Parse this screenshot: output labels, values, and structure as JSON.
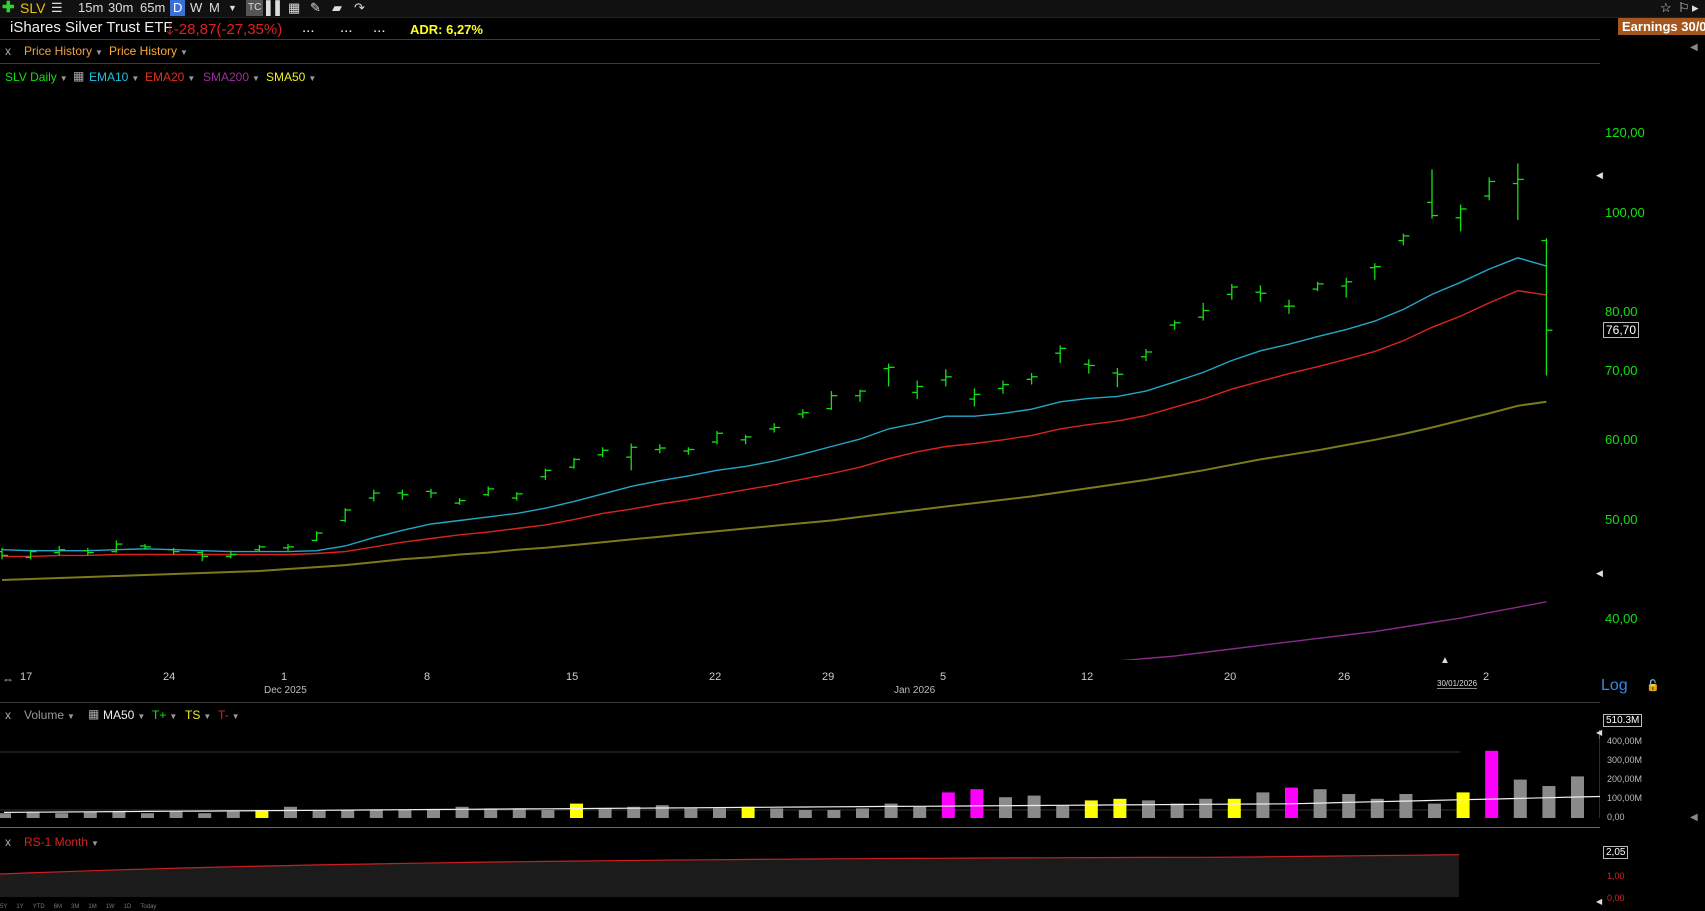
{
  "toolbar": {
    "symbol": "SLV",
    "intervals": [
      "15m",
      "30m",
      "65m",
      "D",
      "W",
      "M"
    ],
    "active_interval": "D"
  },
  "header": {
    "name": "iShares Silver Trust ETF",
    "change": "-28,87",
    "change_pct": "(-27,35%)",
    "dots": [
      "...",
      "...",
      "..."
    ],
    "adr": "ADR: 6,27%",
    "earnings": "Earnings 30/0",
    "tab1": "Price History",
    "tab2": "Price History"
  },
  "legend": {
    "series": "SLV Daily",
    "ema10": "EMA10",
    "ema20": "EMA20",
    "sma200": "SMA200",
    "sma50": "SMA50",
    "close": "x"
  },
  "colors": {
    "bar": "#13e013",
    "ema10": "#22a7c8",
    "ema20": "#d9241e",
    "sma50": "#7a7a1e",
    "sma200": "#8a2a8a",
    "vol_gray": "#8a8a8a",
    "vol_yellow": "#ffff00",
    "vol_magenta": "#ff00ff"
  },
  "price_axis": {
    "ticks": [
      "120,00",
      "100,00",
      "80,00",
      "70,00",
      "60,00",
      "50,00",
      "40,00"
    ],
    "last": "76,70",
    "scale": "Log"
  },
  "date_axis": {
    "ticks": [
      "17",
      "24",
      "1",
      "8",
      "15",
      "22",
      "29",
      "5",
      "12",
      "20",
      "26",
      "2"
    ],
    "months": [
      "Dec 2025",
      "Jan 2026"
    ],
    "selected": "30/01/2026"
  },
  "chart_data": {
    "type": "bar",
    "ylim": [
      36,
      130
    ],
    "log": true,
    "series": [
      {
        "name": "SLV Daily",
        "type": "ohlc",
        "values": [
          [
            46.4,
            46.8,
            45.6,
            46.0
          ],
          [
            45.8,
            46.6,
            45.6,
            46.4
          ],
          [
            46.3,
            47.0,
            46.0,
            46.6
          ],
          [
            46.5,
            46.8,
            46.0,
            46.3
          ],
          [
            46.4,
            47.6,
            46.3,
            47.2
          ],
          [
            47.0,
            47.2,
            46.6,
            46.9
          ],
          [
            46.6,
            46.8,
            46.1,
            46.4
          ],
          [
            46.3,
            46.5,
            45.4,
            45.9
          ],
          [
            45.9,
            46.5,
            45.7,
            46.1
          ],
          [
            46.6,
            47.1,
            46.4,
            46.9
          ],
          [
            46.8,
            47.2,
            46.5,
            46.9
          ],
          [
            47.6,
            48.6,
            47.5,
            48.4
          ],
          [
            49.8,
            51.2,
            49.6,
            51.0
          ],
          [
            52.4,
            53.4,
            52.0,
            53.0
          ],
          [
            53.0,
            53.4,
            52.2,
            52.8
          ],
          [
            53.2,
            53.5,
            52.4,
            53.0
          ],
          [
            51.8,
            52.4,
            51.6,
            52.1
          ],
          [
            52.8,
            53.8,
            52.6,
            53.5
          ],
          [
            52.4,
            53.1,
            52.1,
            52.9
          ],
          [
            55.0,
            56.0,
            54.6,
            55.8
          ],
          [
            56.2,
            57.4,
            56.0,
            57.2
          ],
          [
            57.8,
            58.8,
            57.5,
            58.4
          ],
          [
            57.5,
            59.3,
            55.8,
            58.8
          ],
          [
            58.5,
            59.2,
            58.0,
            58.7
          ],
          [
            58.3,
            58.8,
            57.8,
            58.5
          ],
          [
            59.5,
            61.0,
            59.2,
            60.7
          ],
          [
            59.8,
            60.5,
            59.2,
            60.2
          ],
          [
            61.3,
            62.1,
            60.8,
            61.5
          ],
          [
            63.4,
            64.1,
            62.8,
            63.6
          ],
          [
            64.2,
            66.8,
            64.0,
            66.1
          ],
          [
            66.1,
            67.0,
            65.2,
            66.8
          ],
          [
            70.3,
            71.1,
            67.5,
            70.5
          ],
          [
            66.6,
            68.4,
            65.6,
            67.5
          ],
          [
            68.5,
            70.2,
            67.5,
            69.0
          ],
          [
            65.6,
            67.2,
            64.5,
            66.3
          ],
          [
            67.2,
            68.4,
            66.4,
            67.8
          ],
          [
            68.6,
            69.6,
            67.8,
            69.0
          ],
          [
            72.8,
            74.1,
            71.2,
            73.6
          ],
          [
            71.0,
            71.8,
            69.5,
            70.8
          ],
          [
            69.6,
            70.4,
            67.4,
            69.4
          ],
          [
            72.2,
            73.5,
            71.5,
            73.0
          ],
          [
            77.6,
            78.4,
            76.8,
            78.0
          ],
          [
            79.0,
            81.6,
            78.4,
            80.2
          ],
          [
            83.2,
            85.2,
            82.2,
            84.6
          ],
          [
            83.6,
            84.9,
            81.8,
            83.4
          ],
          [
            81.0,
            82.2,
            79.6,
            81.0
          ],
          [
            84.2,
            85.6,
            83.8,
            85.2
          ],
          [
            84.8,
            86.4,
            82.6,
            85.6
          ],
          [
            88.4,
            89.3,
            86.0,
            88.6
          ],
          [
            94.0,
            95.5,
            93.0,
            95.0
          ],
          [
            102.5,
            110.5,
            98.8,
            99.5
          ],
          [
            99.0,
            102.0,
            96.0,
            101.0
          ],
          [
            104.0,
            108.5,
            103.0,
            107.5
          ],
          [
            107.0,
            112.0,
            98.5,
            108.0
          ],
          [
            94.0,
            94.5,
            69.2,
            76.7
          ]
        ]
      },
      {
        "name": "EMA10",
        "values": [
          46.6,
          46.5,
          46.5,
          46.5,
          46.6,
          46.7,
          46.6,
          46.5,
          46.4,
          46.4,
          46.4,
          46.5,
          47.0,
          47.9,
          48.7,
          49.4,
          49.8,
          50.2,
          50.6,
          51.2,
          52.0,
          52.9,
          53.8,
          54.5,
          55.1,
          55.8,
          56.3,
          57.0,
          57.9,
          58.9,
          59.9,
          61.3,
          62.1,
          63.1,
          63.1,
          63.5,
          64.1,
          65.2,
          65.7,
          66.0,
          66.8,
          68.2,
          69.7,
          71.6,
          73.2,
          74.3,
          75.6,
          76.8,
          78.3,
          80.4,
          83.2,
          85.5,
          88.1,
          90.4,
          88.7
        ]
      },
      {
        "name": "EMA20",
        "values": [
          45.9,
          45.9,
          46.0,
          46.0,
          46.1,
          46.1,
          46.1,
          46.1,
          46.1,
          46.1,
          46.1,
          46.2,
          46.4,
          46.9,
          47.4,
          47.8,
          48.2,
          48.5,
          48.9,
          49.3,
          49.9,
          50.6,
          51.1,
          51.7,
          52.2,
          52.8,
          53.4,
          54.0,
          54.7,
          55.4,
          56.2,
          57.3,
          58.2,
          58.9,
          59.3,
          59.8,
          60.4,
          61.3,
          61.9,
          62.4,
          63.2,
          64.4,
          65.6,
          67.1,
          68.3,
          69.5,
          70.6,
          71.8,
          73.1,
          74.9,
          77.2,
          79.2,
          81.6,
          83.9,
          83.1
        ]
      },
      {
        "name": "SMA50",
        "values": [
          43.5,
          43.6,
          43.7,
          43.8,
          43.9,
          44.0,
          44.1,
          44.2,
          44.3,
          44.4,
          44.6,
          44.8,
          45.0,
          45.3,
          45.6,
          45.8,
          46.1,
          46.3,
          46.6,
          46.8,
          47.1,
          47.4,
          47.7,
          48.0,
          48.3,
          48.6,
          48.9,
          49.2,
          49.5,
          49.8,
          50.2,
          50.6,
          51.0,
          51.4,
          51.8,
          52.2,
          52.6,
          53.1,
          53.6,
          54.1,
          54.6,
          55.2,
          55.8,
          56.5,
          57.2,
          57.8,
          58.4,
          59.1,
          59.8,
          60.6,
          61.5,
          62.5,
          63.5,
          64.6,
          65.2
        ]
      },
      {
        "name": "SMA200",
        "values": [
          31.0,
          31.1,
          31.2,
          31.3,
          31.4,
          31.5,
          31.6,
          31.7,
          31.8,
          31.9,
          32.0,
          32.1,
          32.2,
          32.3,
          32.4,
          32.5,
          32.6,
          32.7,
          32.8,
          32.9,
          33.0,
          33.1,
          33.2,
          33.4,
          33.5,
          33.7,
          33.8,
          33.9,
          34.1,
          34.3,
          34.4,
          34.6,
          34.8,
          35.0,
          35.2,
          35.4,
          35.6,
          35.8,
          36.0,
          36.2,
          36.4,
          36.6,
          36.9,
          37.2,
          37.5,
          37.8,
          38.1,
          38.4,
          38.7,
          39.1,
          39.5,
          39.9,
          40.4,
          40.9,
          41.4
        ]
      }
    ]
  },
  "volume": {
    "title": "Volume",
    "ma": "MA50",
    "t_plus": "T+",
    "ts": "TS",
    "t_minus": "T-",
    "last": "510.3M",
    "ticks": [
      "400,00M",
      "300,00M",
      "200,00M",
      "100,00M",
      "0,00"
    ],
    "values": [
      30,
      35,
      30,
      35,
      40,
      30,
      45,
      40,
      30,
      40,
      45,
      45,
      40,
      50,
      70,
      75,
      50,
      60,
      55,
      50,
      75,
      50,
      60,
      70,
      80,
      60,
      50,
      55,
      75,
      80,
      65,
      45,
      80,
      50,
      45,
      50,
      55,
      80,
      75,
      85,
      60,
      50,
      60,
      50,
      40,
      70,
      60,
      50,
      80,
      150,
      155,
      125,
      130,
      130,
      95,
      110,
      145,
      145,
      75,
      115,
      120,
      120,
      95,
      90,
      120,
      120,
      135,
      180,
      165,
      110,
      95,
      170,
      170,
      130,
      110,
      150,
      150,
      180,
      210,
      200,
      395,
      215,
      185,
      245,
      485,
      510.3
    ],
    "vol_bars": [
      [
        0.03,
        "g"
      ],
      [
        0.04,
        "g"
      ],
      [
        0.03,
        "g"
      ],
      [
        0.04,
        "g"
      ],
      [
        0.04,
        "g"
      ],
      [
        0.03,
        "g"
      ],
      [
        0.04,
        "g"
      ],
      [
        0.03,
        "g"
      ],
      [
        0.04,
        "g"
      ],
      [
        0.05,
        "y"
      ],
      [
        0.07,
        "g"
      ],
      [
        0.05,
        "g"
      ],
      [
        0.05,
        "g"
      ],
      [
        0.05,
        "g"
      ],
      [
        0.05,
        "g"
      ],
      [
        0.05,
        "g"
      ],
      [
        0.07,
        "g"
      ],
      [
        0.06,
        "g"
      ],
      [
        0.06,
        "g"
      ],
      [
        0.05,
        "g"
      ],
      [
        0.09,
        "y"
      ],
      [
        0.06,
        "g"
      ],
      [
        0.07,
        "g"
      ],
      [
        0.08,
        "g"
      ],
      [
        0.06,
        "g"
      ],
      [
        0.06,
        "g"
      ],
      [
        0.07,
        "y"
      ],
      [
        0.06,
        "g"
      ],
      [
        0.05,
        "g"
      ],
      [
        0.05,
        "g"
      ],
      [
        0.06,
        "g"
      ],
      [
        0.09,
        "g"
      ],
      [
        0.07,
        "g"
      ],
      [
        0.16,
        "m"
      ],
      [
        0.18,
        "m"
      ],
      [
        0.13,
        "g"
      ],
      [
        0.14,
        "g"
      ],
      [
        0.08,
        "g"
      ],
      [
        0.11,
        "y"
      ],
      [
        0.12,
        "y"
      ],
      [
        0.11,
        "g"
      ],
      [
        0.09,
        "g"
      ],
      [
        0.12,
        "g"
      ],
      [
        0.12,
        "y"
      ],
      [
        0.16,
        "g"
      ],
      [
        0.19,
        "m"
      ],
      [
        0.18,
        "g"
      ],
      [
        0.15,
        "g"
      ],
      [
        0.12,
        "g"
      ],
      [
        0.15,
        "g"
      ],
      [
        0.09,
        "g"
      ],
      [
        0.16,
        "y"
      ],
      [
        0.42,
        "m"
      ],
      [
        0.24,
        "g"
      ],
      [
        0.2,
        "g"
      ],
      [
        0.26,
        "g"
      ],
      [
        0.55,
        "m"
      ]
    ]
  },
  "rs": {
    "title": "RS-1 Month",
    "last": "2,05",
    "ticks": [
      "1,00",
      "0,00"
    ]
  },
  "bottom_ranges": [
    "5Y",
    "1Y",
    "YTD",
    "6M",
    "3M",
    "1M",
    "1W",
    "1D",
    "Today"
  ]
}
